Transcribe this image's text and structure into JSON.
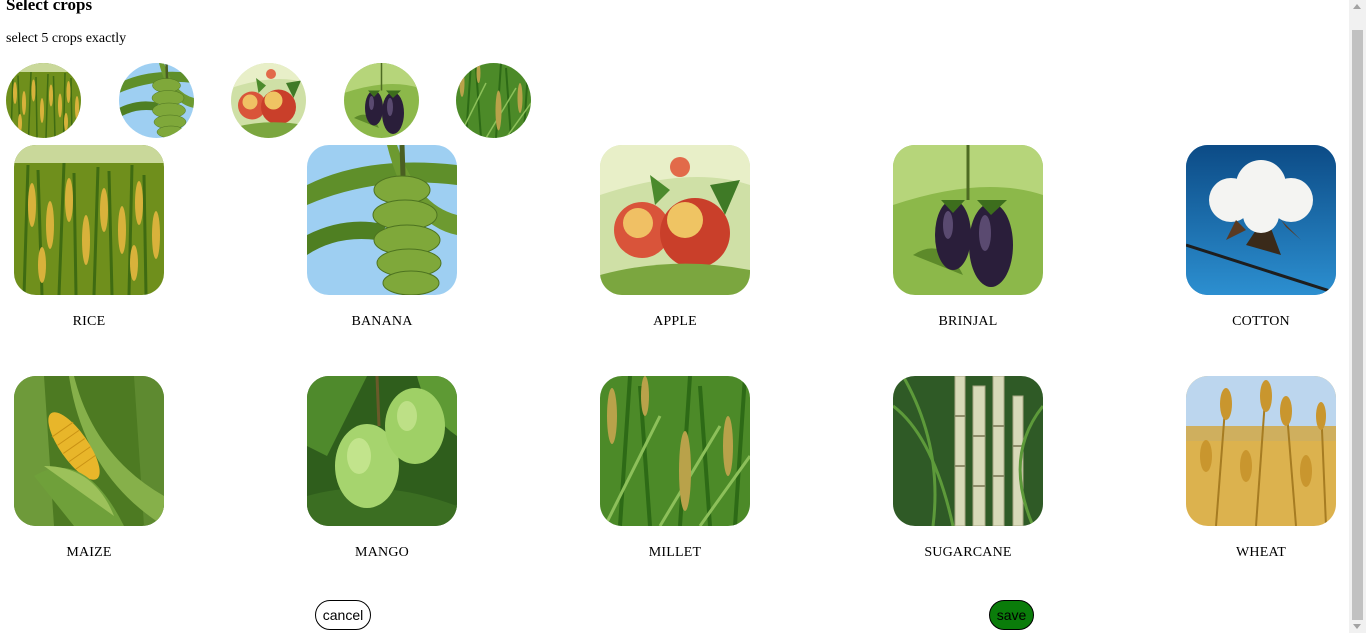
{
  "page": {
    "title": "Select crops",
    "instruction": "select 5 crops exactly"
  },
  "selected": [
    {
      "name": "rice",
      "icon": "rice-photo"
    },
    {
      "name": "banana",
      "icon": "banana-photo"
    },
    {
      "name": "apple",
      "icon": "apple-photo"
    },
    {
      "name": "brinjal",
      "icon": "brinjal-photo"
    },
    {
      "name": "millet",
      "icon": "millet-photo"
    }
  ],
  "crops": [
    {
      "label": "RICE",
      "icon": "rice-photo"
    },
    {
      "label": "BANANA",
      "icon": "banana-photo"
    },
    {
      "label": "APPLE",
      "icon": "apple-photo"
    },
    {
      "label": "BRINJAL",
      "icon": "brinjal-photo"
    },
    {
      "label": "COTTON",
      "icon": "cotton-photo"
    },
    {
      "label": "MAIZE",
      "icon": "maize-photo"
    },
    {
      "label": "MANGO",
      "icon": "mango-photo"
    },
    {
      "label": "MILLET",
      "icon": "millet-photo"
    },
    {
      "label": "SUGARCANE",
      "icon": "sugarcane-photo"
    },
    {
      "label": "WHEAT",
      "icon": "wheat-photo"
    }
  ],
  "buttons": {
    "cancel": "cancel",
    "save": "save"
  },
  "colors": {
    "save_button": "#0a7c0a"
  }
}
